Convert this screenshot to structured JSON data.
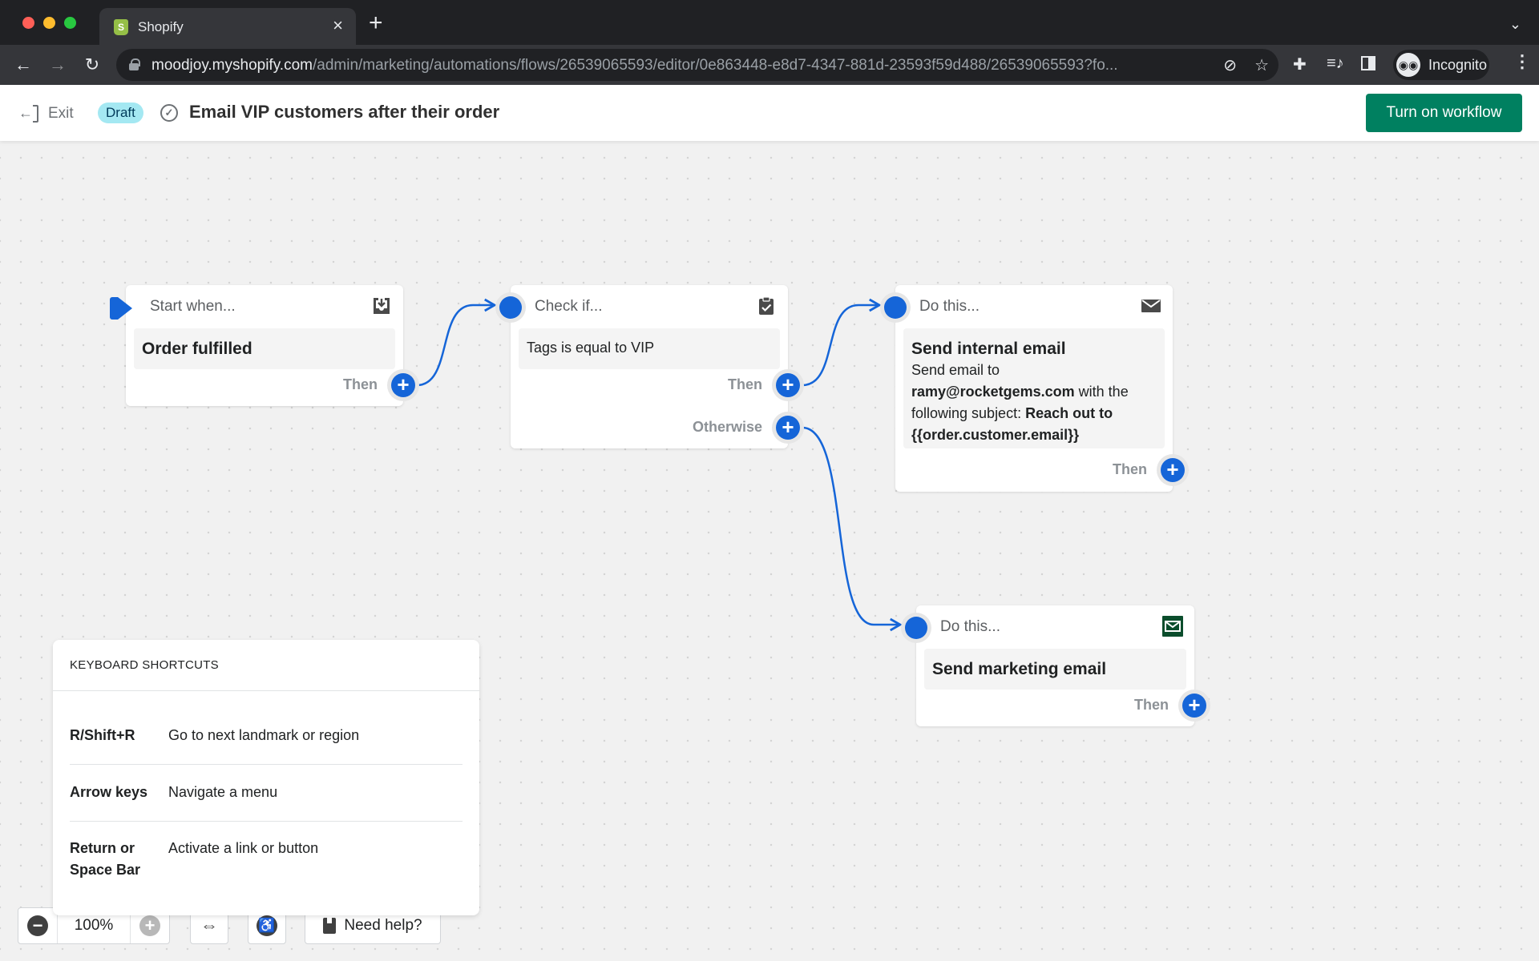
{
  "browser": {
    "tab_title": "Shopify",
    "tab_close": "×",
    "new_tab": "+",
    "tab_menu": "⌄",
    "url_host": "moodjoy.myshopify.com",
    "url_path": "/admin/marketing/automations/flows/26539065593/editor/0e863448-e8d7-4347-881d-23593f59d488/26539065593?fo...",
    "profile_label": "Incognito",
    "icons": {
      "back": "←",
      "forward": "→",
      "reload": "↻",
      "eye_off": "⊘",
      "star": "☆",
      "extensions": "✚",
      "media": "≡♪",
      "incognito": "◉◉",
      "menu": "⋮"
    }
  },
  "header": {
    "exit_label": "Exit",
    "status_badge": "Draft",
    "status_check": "✓",
    "title": "Email VIP customers after their order",
    "primary_action": "Turn on workflow",
    "accent_color": "#008060"
  },
  "flow": {
    "connector_color": "#1565d8",
    "nodes": [
      {
        "id": "trigger",
        "kind": "Start when...",
        "icon": "inbox-download-icon",
        "title": "Order fulfilled",
        "ports": [
          "Then"
        ]
      },
      {
        "id": "condition",
        "kind": "Check if...",
        "icon": "clipboard-check-icon",
        "body": "Tags is equal to VIP",
        "ports": [
          "Then",
          "Otherwise"
        ]
      },
      {
        "id": "action-internal",
        "kind": "Do this...",
        "icon": "envelope-icon",
        "title": "Send internal email",
        "desc_prefix": "Send email to",
        "desc_email": "ramy@rocketgems.com",
        "desc_middle": "with the following subject:",
        "desc_subject": "Reach out to {{order.customer.email}}",
        "ports": [
          "Then"
        ]
      },
      {
        "id": "action-marketing",
        "kind": "Do this...",
        "icon": "envelope-green-icon",
        "title": "Send marketing email",
        "ports": [
          "Then"
        ]
      }
    ],
    "port_plus": "+"
  },
  "shortcuts": {
    "title": "KEYBOARD SHORTCUTS",
    "rows": [
      {
        "key": "R/Shift+R",
        "desc": "Go to next landmark or region"
      },
      {
        "key": "Arrow keys",
        "desc": "Navigate a menu"
      },
      {
        "key": "Return or Space Bar",
        "desc": "Activate a link or button"
      }
    ]
  },
  "controls": {
    "zoom_level": "100%",
    "zoom_out": "−",
    "zoom_in": "+",
    "fit": "⇔",
    "accessibility": "♿",
    "help_label": "Need help?"
  }
}
